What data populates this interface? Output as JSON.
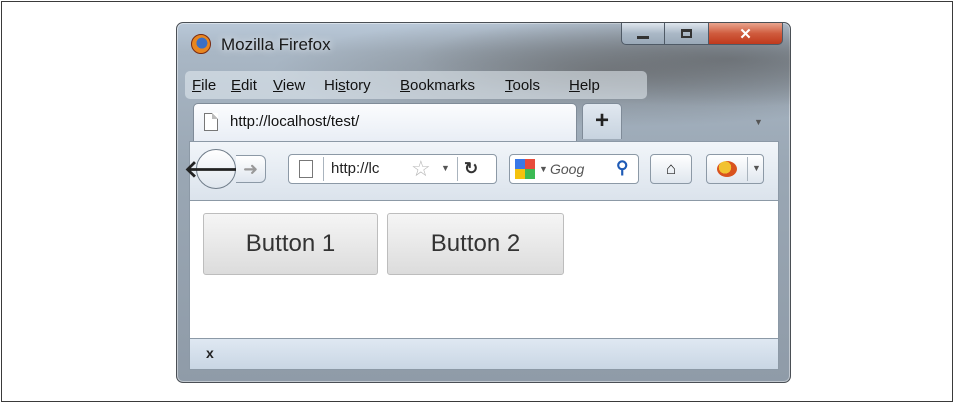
{
  "window": {
    "title": "Mozilla Firefox"
  },
  "menu": {
    "items": [
      {
        "pre": "",
        "key": "F",
        "post": "ile"
      },
      {
        "pre": "",
        "key": "E",
        "post": "dit"
      },
      {
        "pre": "",
        "key": "V",
        "post": "iew"
      },
      {
        "pre": "Hi",
        "key": "s",
        "post": "tory"
      },
      {
        "pre": "",
        "key": "B",
        "post": "ookmarks"
      },
      {
        "pre": "",
        "key": "T",
        "post": "ools"
      },
      {
        "pre": "",
        "key": "H",
        "post": "elp"
      }
    ]
  },
  "tab": {
    "label": "http://localhost/test/",
    "new_tab_symbol": "+"
  },
  "navbar": {
    "url_value": "http://lc",
    "search_placeholder": "Goog"
  },
  "page": {
    "buttons": [
      "Button 1",
      "Button 2"
    ]
  },
  "findbar": {
    "close_symbol": "x"
  },
  "colors": {
    "close_button": "#c0391c",
    "chrome": "#dbe3ec"
  },
  "icons": [
    "firefox-icon",
    "minimize-icon",
    "maximize-icon",
    "close-icon",
    "page-icon",
    "back-arrow-icon",
    "forward-arrow-icon",
    "star-icon",
    "reload-icon",
    "google-icon",
    "search-icon",
    "home-icon",
    "firebug-icon"
  ]
}
